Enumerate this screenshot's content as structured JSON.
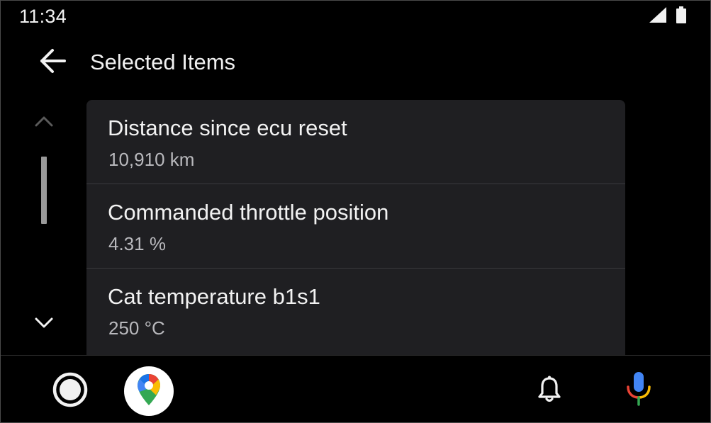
{
  "status_bar": {
    "time": "11:34",
    "icons": [
      "signal-icon",
      "battery-icon"
    ]
  },
  "header": {
    "back_icon": "arrow-back-icon",
    "title": "Selected Items"
  },
  "scroll": {
    "up_icon": "chevron-up-icon",
    "down_icon": "chevron-down-icon"
  },
  "list": {
    "items": [
      {
        "title": "Distance since ecu reset",
        "value": "10,910 km"
      },
      {
        "title": "Commanded throttle position",
        "value": "4.31 %"
      },
      {
        "title": "Cat temperature b1s1",
        "value": "250 °C"
      }
    ]
  },
  "bottom_bar": {
    "home_icon": "home-circle-icon",
    "maps_icon": "google-maps-icon",
    "notification_icon": "bell-icon",
    "voice_icon": "microphone-icon"
  },
  "colors": {
    "background": "#000000",
    "card": "#1f1f22",
    "divider": "#3a3a3e",
    "text_primary": "#f2f2f2",
    "text_secondary": "#b9b9bd"
  }
}
